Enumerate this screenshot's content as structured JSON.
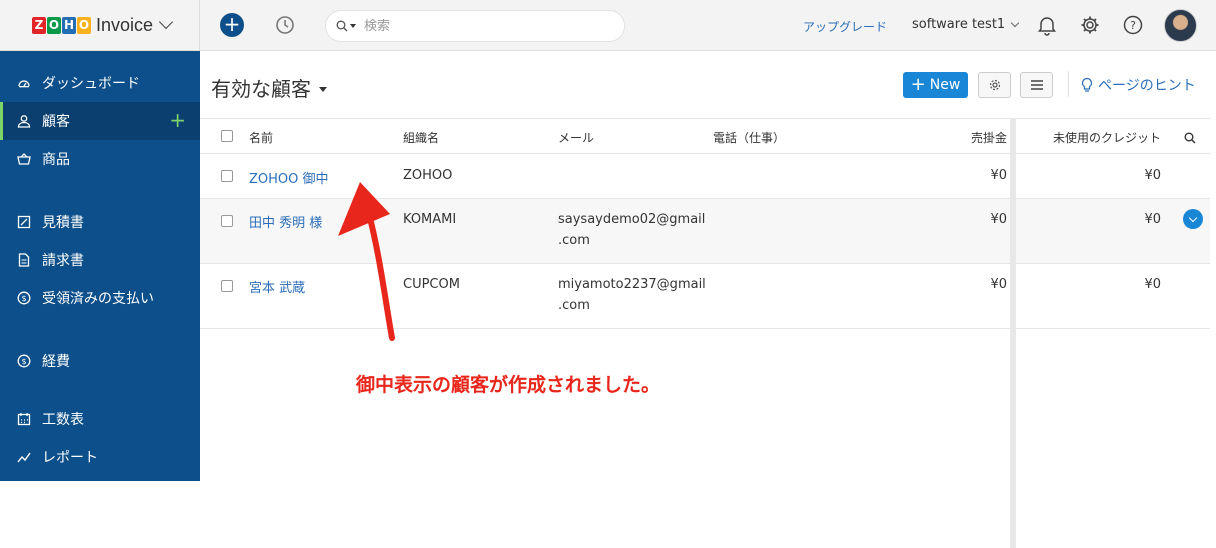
{
  "brand": {
    "logo_letters": [
      "Z",
      "O",
      "H",
      "O"
    ],
    "logo_colors": [
      "#e42527",
      "#089949",
      "#226db4",
      "#f9b21d"
    ],
    "name": "Invoice"
  },
  "sidebar": {
    "items": [
      {
        "label": "ダッシュボード",
        "icon": "dashboard-icon"
      },
      {
        "label": "顧客",
        "icon": "user-icon",
        "active": true
      },
      {
        "label": "商品",
        "icon": "basket-icon"
      },
      {
        "label": "見積書",
        "icon": "estimate-icon"
      },
      {
        "label": "請求書",
        "icon": "invoice-icon"
      },
      {
        "label": "受領済みの支払い",
        "icon": "payment-icon"
      },
      {
        "label": "経費",
        "icon": "expense-icon"
      },
      {
        "label": "工数表",
        "icon": "calendar-icon"
      },
      {
        "label": "レポート",
        "icon": "report-icon"
      }
    ],
    "accent_color": "#7fd36b",
    "bg_color": "#0d4f8a"
  },
  "topbar": {
    "search_placeholder": "検索",
    "upgrade_label": "アップグレード",
    "org_name": "software test1"
  },
  "page": {
    "title": "有効な顧客",
    "new_button_label": "New",
    "hint_label": "ページのヒント"
  },
  "table": {
    "columns": [
      "名前",
      "組織名",
      "メール",
      "電話（仕事）",
      "売掛金",
      "未使用のクレジット"
    ],
    "rows": [
      {
        "name": "ZOHOO 御中",
        "org": "ZOHOO",
        "email_line1": "",
        "email_line2": "",
        "phone": "",
        "receivable": "¥0",
        "credit": "¥0"
      },
      {
        "name": "田中 秀明 様",
        "org": "KOMAMI",
        "email_line1": "saysaydemo02@gmail",
        "email_line2": ".com",
        "phone": "",
        "receivable": "¥0",
        "credit": "¥0"
      },
      {
        "name": "宮本 武蔵",
        "org": "CUPCOM",
        "email_line1": "miyamoto2237@gmail",
        "email_line2": ".com",
        "phone": "",
        "receivable": "¥0",
        "credit": "¥0"
      }
    ]
  },
  "annotation": {
    "text": "御中表示の顧客が作成されました。",
    "color": "#e8261b"
  }
}
